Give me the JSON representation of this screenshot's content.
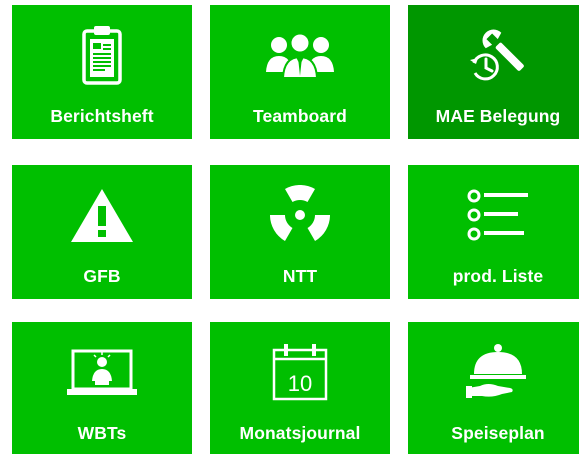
{
  "tiles": [
    {
      "label": "Berichtsheft",
      "icon": "clipboard-icon"
    },
    {
      "label": "Teamboard",
      "icon": "team-icon"
    },
    {
      "label": "MAE Belegung",
      "icon": "wrench-clock-icon"
    },
    {
      "label": "GFB",
      "icon": "warning-icon"
    },
    {
      "label": "NTT",
      "icon": "radiation-icon"
    },
    {
      "label": "prod. Liste",
      "icon": "list-icon"
    },
    {
      "label": "WBTs",
      "icon": "laptop-person-icon"
    },
    {
      "label": "Monatsjournal",
      "icon": "calendar-icon"
    },
    {
      "label": "Speiseplan",
      "icon": "serving-dish-icon"
    }
  ],
  "calendar_day": "10",
  "colors": {
    "tile": "#00bf00",
    "tile_active": "#009700",
    "text": "#ffffff"
  }
}
